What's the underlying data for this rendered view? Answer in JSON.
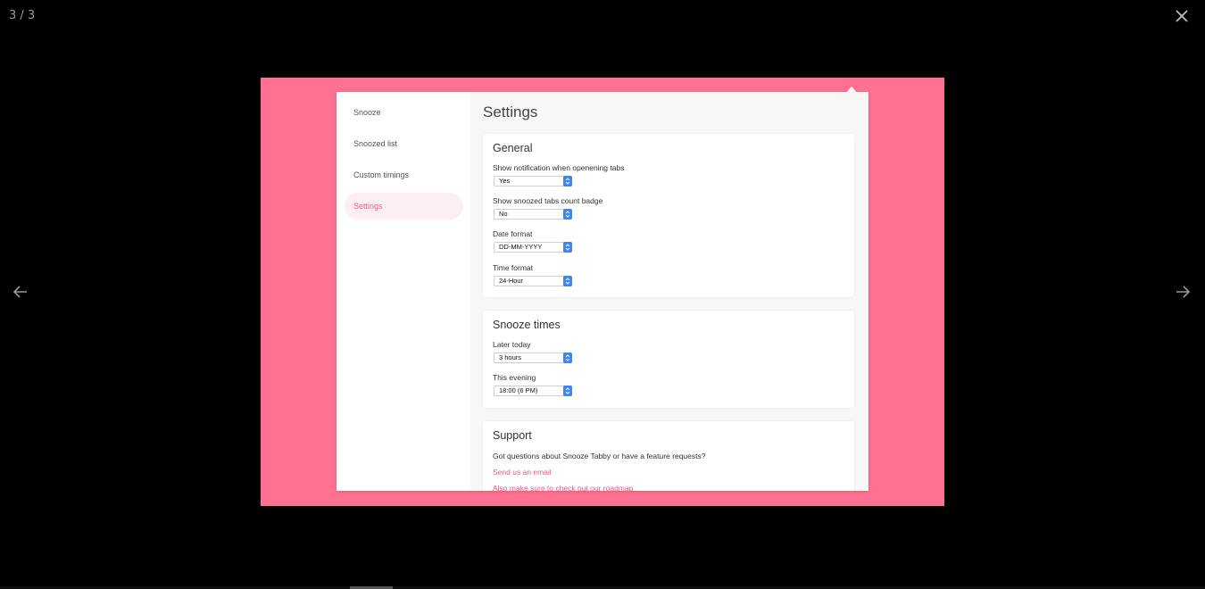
{
  "viewer": {
    "counter": "3 / 3",
    "icons": {
      "close": "close-icon",
      "prev": "arrow-left-icon",
      "next": "arrow-right-icon"
    }
  },
  "colors": {
    "slide_bg": "#fe7190",
    "accent": "#f25d7f",
    "stepper": "#3d84f6"
  },
  "sidebar": {
    "items": [
      {
        "label": "Snooze"
      },
      {
        "label": "Snoozed list"
      },
      {
        "label": "Custom timings"
      },
      {
        "label": "Settings",
        "active": true
      }
    ]
  },
  "main": {
    "title": "Settings",
    "general": {
      "title": "General",
      "fields": [
        {
          "label": "Show notification when openening tabs",
          "value": "Yes"
        },
        {
          "label": "Show snoozed tabs count badge",
          "value": "No"
        },
        {
          "label": "Date format",
          "value": "DD-MM-YYYY"
        },
        {
          "label": "Time format",
          "value": "24-Hour"
        }
      ]
    },
    "snooze_times": {
      "title": "Snooze times",
      "fields": [
        {
          "label": "Later today",
          "value": "3 hours"
        },
        {
          "label": "This evening",
          "value": "18:00 (6 PM)"
        }
      ]
    },
    "support": {
      "title": "Support",
      "text": "Got questions about Snooze Tabby or have a feature requests?",
      "links": [
        {
          "label": "Send us an email"
        },
        {
          "label": "Also make sure to check out our roadmap"
        }
      ]
    }
  }
}
